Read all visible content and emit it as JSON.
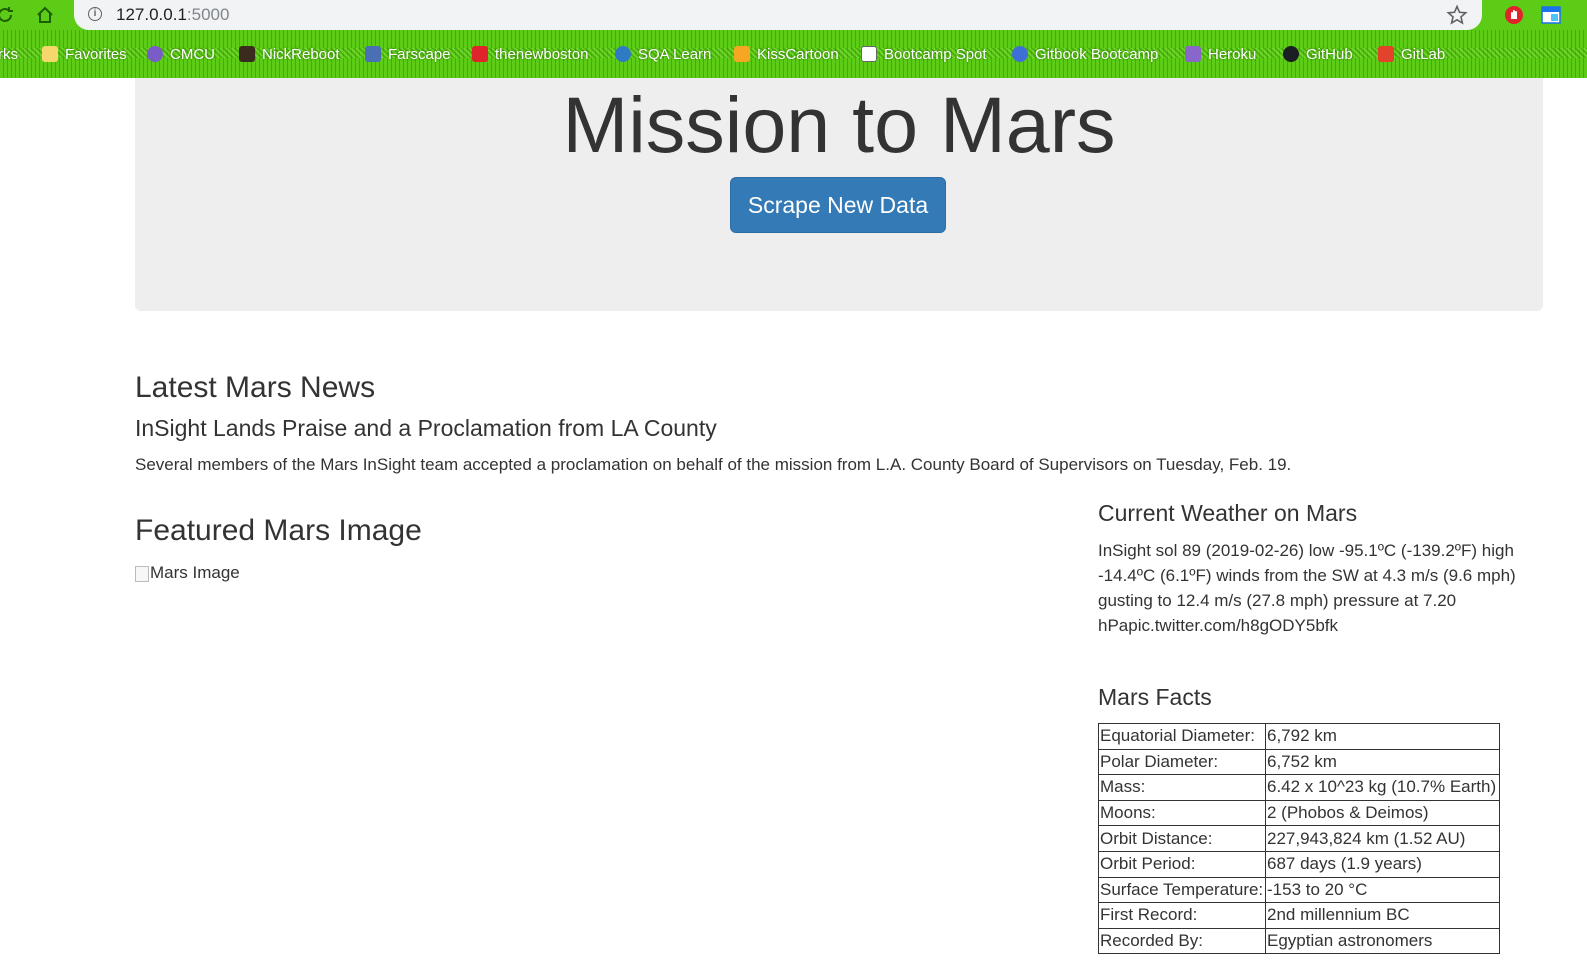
{
  "browser": {
    "url_host": "127.0.0.1",
    "url_port": ":5000",
    "colors": {
      "toolbar": "#5ccc16",
      "omnibox": "#f1f3f4"
    },
    "bookmarks": [
      {
        "label": "rks",
        "icon": "none"
      },
      {
        "label": "Favorites",
        "icon": "folder-icon",
        "color": "#f5d76e"
      },
      {
        "label": "CMCU",
        "icon": "cmcu-icon",
        "color": "#7a5cc9"
      },
      {
        "label": "NickReboot",
        "icon": "nickreboot-icon",
        "color": "#3b2b1e"
      },
      {
        "label": "Farscape",
        "icon": "farscape-icon",
        "color": "#4a6fb5"
      },
      {
        "label": "thenewboston",
        "icon": "thenewboston-icon",
        "color": "#e0242b"
      },
      {
        "label": "SQA Learn",
        "icon": "sqa-learn-icon",
        "color": "#2e7bc4"
      },
      {
        "label": "KissCartoon",
        "icon": "kisscartoon-icon",
        "color": "#f5a623"
      },
      {
        "label": "Bootcamp Spot",
        "icon": "page-icon",
        "color": "#ffffff"
      },
      {
        "label": "Gitbook Bootcamp",
        "icon": "gitbook-icon",
        "color": "#3d6fd6"
      },
      {
        "label": "Heroku",
        "icon": "heroku-icon",
        "color": "#8966c9"
      },
      {
        "label": "GitHub",
        "icon": "github-icon",
        "color": "#1b1f23"
      },
      {
        "label": "GitLab",
        "icon": "gitlab-icon",
        "color": "#e2432a"
      }
    ]
  },
  "page": {
    "title": "Mission to Mars",
    "scrape_button": "Scrape New Data",
    "button_color": "#337ab7",
    "news": {
      "heading": "Latest Mars News",
      "title": "InSight Lands Praise and a Proclamation from LA County",
      "paragraph": "Several members of the Mars InSight team accepted a proclamation on behalf of the mission from L.A. County Board of Supervisors on Tuesday, Feb. 19."
    },
    "featured": {
      "heading": "Featured Mars Image",
      "alt": "Mars Image"
    },
    "weather": {
      "heading": "Current Weather on Mars",
      "text": "InSight sol 89 (2019-02-26) low -95.1ºC (-139.2ºF) high -14.4ºC (6.1ºF) winds from the SW at 4.3 m/s (9.6 mph) gusting to 12.4 m/s (27.8 mph) pressure at 7.20 hPapic.twitter.com/h8gODY5bfk"
    },
    "facts": {
      "heading": "Mars Facts",
      "rows": [
        {
          "key": "Equatorial Diameter:",
          "value": "6,792 km"
        },
        {
          "key": "Polar Diameter:",
          "value": "6,752 km"
        },
        {
          "key": "Mass:",
          "value": "6.42 x 10^23 kg (10.7% Earth)"
        },
        {
          "key": "Moons:",
          "value": "2 (Phobos & Deimos)"
        },
        {
          "key": "Orbit Distance:",
          "value": "227,943,824 km (1.52 AU)"
        },
        {
          "key": "Orbit Period:",
          "value": "687 days (1.9 years)"
        },
        {
          "key": "Surface Temperature:",
          "value": "-153 to 20 °C"
        },
        {
          "key": "First Record:",
          "value": "2nd millennium BC"
        },
        {
          "key": "Recorded By:",
          "value": "Egyptian astronomers"
        }
      ]
    }
  }
}
